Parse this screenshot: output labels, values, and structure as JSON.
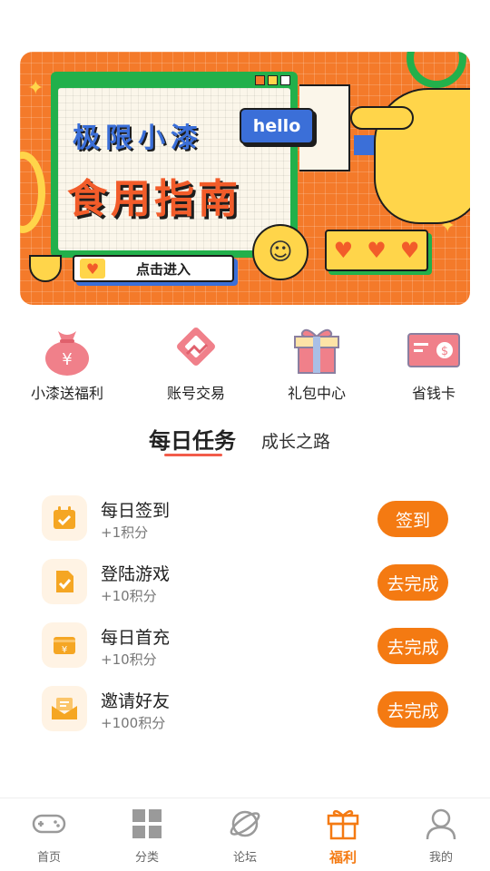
{
  "banner": {
    "title_line1": "极限小漆",
    "title_line2": "食用指南",
    "hello": "hello",
    "enter_label": "点击进入"
  },
  "quick_entries": [
    {
      "label": "小漆送福利",
      "icon": "money-bag-icon"
    },
    {
      "label": "账号交易",
      "icon": "handshake-icon"
    },
    {
      "label": "礼包中心",
      "icon": "gift-icon"
    },
    {
      "label": "省钱卡",
      "icon": "coupon-card-icon"
    }
  ],
  "tabs": {
    "active": "每日任务",
    "inactive": "成长之路"
  },
  "tasks": [
    {
      "title": "每日签到",
      "points": "+1积分",
      "button": "签到",
      "icon": "calendar-check-icon"
    },
    {
      "title": "登陆游戏",
      "points": "+10积分",
      "button": "去完成",
      "icon": "document-check-icon"
    },
    {
      "title": "每日首充",
      "points": "+10积分",
      "button": "去完成",
      "icon": "wallet-yuan-icon"
    },
    {
      "title": "邀请好友",
      "points": "+100积分",
      "button": "去完成",
      "icon": "envelope-icon"
    }
  ],
  "bottom_nav": [
    {
      "label": "首页",
      "icon": "gamepad-icon",
      "active": false
    },
    {
      "label": "分类",
      "icon": "grid-icon",
      "active": false
    },
    {
      "label": "论坛",
      "icon": "planet-icon",
      "active": false
    },
    {
      "label": "福利",
      "icon": "gift-icon",
      "active": true
    },
    {
      "label": "我的",
      "icon": "user-icon",
      "active": false
    }
  ],
  "colors": {
    "accent": "#f47a12",
    "banner_bg": "#f47a2a",
    "banner_green": "#22b04b",
    "banner_blue": "#3b6fd8",
    "banner_yellow": "#ffd54a",
    "tab_underline": "#f25c4a"
  }
}
